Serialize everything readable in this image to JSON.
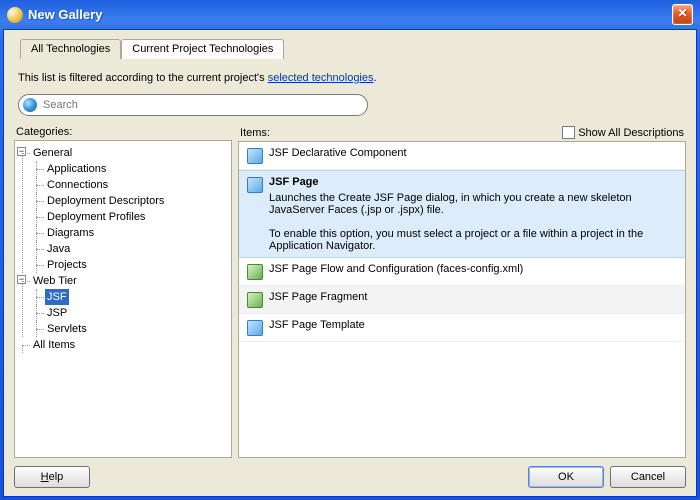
{
  "window": {
    "title": "New Gallery"
  },
  "tabs": {
    "all": "All Technologies",
    "current": "Current Project Technologies"
  },
  "desc": {
    "prefix": "This list is filtered according to the current project's ",
    "link": "selected technologies",
    "suffix": "."
  },
  "search": {
    "placeholder": "Search"
  },
  "categories_label": "Categories:",
  "items_label": "Items:",
  "show_all_label": "Show All Descriptions",
  "categories": {
    "general": "General",
    "general_children": [
      "Applications",
      "Connections",
      "Deployment Descriptors",
      "Deployment Profiles",
      "Diagrams",
      "Java",
      "Projects"
    ],
    "web": "Web Tier",
    "web_children": [
      "JSF",
      "JSP",
      "Servlets"
    ],
    "all_items": "All Items"
  },
  "items": [
    {
      "label": "JSF Declarative Component",
      "selected": false,
      "icon": "b"
    },
    {
      "label": "JSF Page",
      "selected": true,
      "icon": "b",
      "desc1": "Launches the Create JSF Page dialog, in which you create a new skeleton JavaServer Faces (.jsp or .jspx) file.",
      "desc2": "To enable this option, you must select a project or a file within a project in the Application Navigator."
    },
    {
      "label": "JSF Page Flow and Configuration (faces-config.xml)",
      "selected": false,
      "icon": "g"
    },
    {
      "label": "JSF Page Fragment",
      "selected": false,
      "icon": "g",
      "hover": true
    },
    {
      "label": "JSF Page Template",
      "selected": false,
      "icon": "b"
    }
  ],
  "buttons": {
    "help": "Help",
    "ok": "OK",
    "cancel": "Cancel"
  }
}
